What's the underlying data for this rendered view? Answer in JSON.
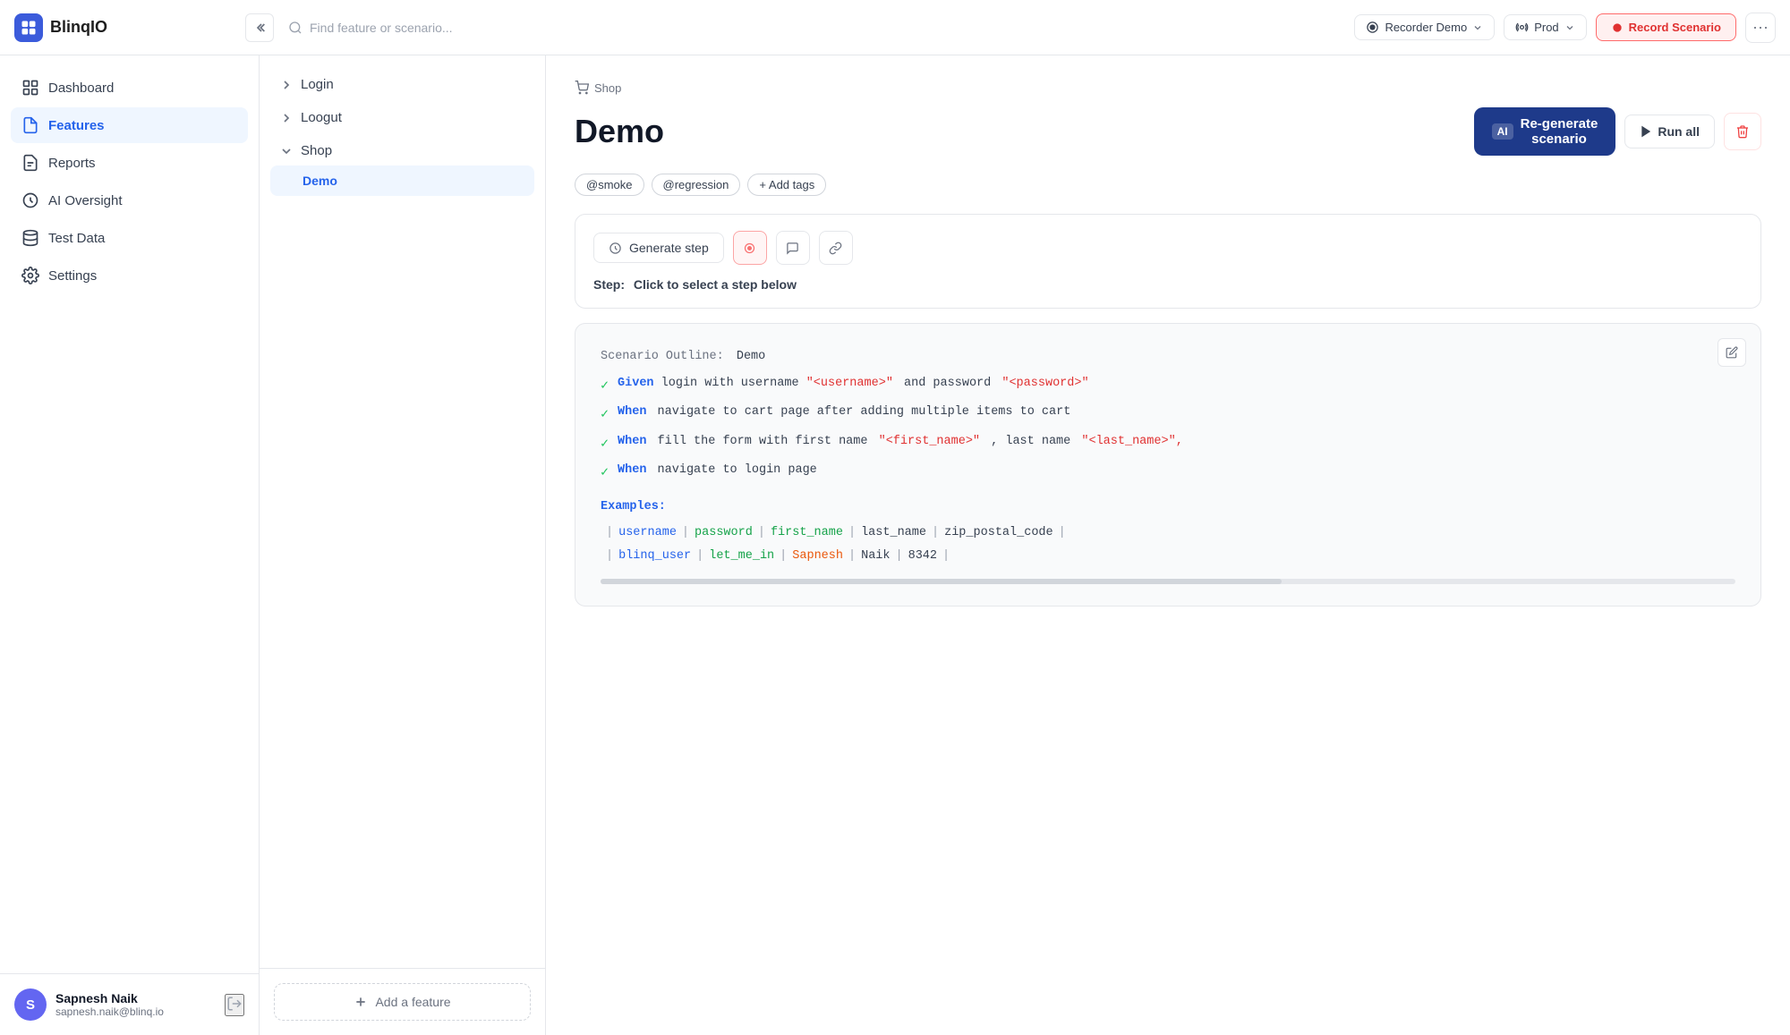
{
  "app": {
    "name": "BlinqIO",
    "logo_alt": "BlinqIO logo"
  },
  "header": {
    "search_placeholder": "Find feature or scenario...",
    "recorder": "Recorder Demo",
    "env": "Prod",
    "record_button": "Record Scenario",
    "more_alt": "more options"
  },
  "sidebar": {
    "nav_items": [
      {
        "id": "dashboard",
        "label": "Dashboard"
      },
      {
        "id": "features",
        "label": "Features",
        "active": true
      },
      {
        "id": "reports",
        "label": "Reports"
      },
      {
        "id": "ai-oversight",
        "label": "AI Oversight"
      },
      {
        "id": "test-data",
        "label": "Test Data"
      },
      {
        "id": "settings",
        "label": "Settings"
      }
    ],
    "user": {
      "name": "Sapnesh Naik",
      "email": "sapnesh.naik@blinq.io",
      "avatar_initial": "S"
    }
  },
  "feature_panel": {
    "groups": [
      {
        "id": "login",
        "label": "Login",
        "expanded": false,
        "scenarios": []
      },
      {
        "id": "loogut",
        "label": "Loogut",
        "expanded": false,
        "scenarios": []
      },
      {
        "id": "shop",
        "label": "Shop",
        "expanded": true,
        "scenarios": [
          {
            "id": "demo",
            "label": "Demo",
            "active": true
          }
        ]
      }
    ],
    "add_button": "Add a feature"
  },
  "main": {
    "breadcrumb": "Shop",
    "title": "Demo",
    "tags": [
      "@smoke",
      "@regression"
    ],
    "add_tag": "+ Add tags",
    "ai_button": {
      "badge": "AI",
      "label": "Re-generate\nscenario"
    },
    "run_all": "Run all",
    "generate_step": "Generate step",
    "step_hint": {
      "prefix": "Step:",
      "text": "Click to select a step below"
    },
    "scenario": {
      "outline_label": "Scenario Outline:",
      "outline_value": "Demo",
      "steps": [
        {
          "keyword": "Given",
          "text": "login with username",
          "param1": "\"<username>\"",
          "mid": "and password",
          "param2": "\"<password>\""
        },
        {
          "keyword": "When",
          "text": "navigate to cart page after adding multiple items to cart"
        },
        {
          "keyword": "When",
          "text": "fill the form with first name",
          "param1": "\"<first_name>\"",
          "mid": ", last name",
          "param2": "\"<last_name>\","
        },
        {
          "keyword": "When",
          "text": "navigate to login page"
        }
      ],
      "examples_label": "Examples:",
      "table_headers": [
        "username",
        "password",
        "first_name",
        "last_name",
        "zip_postal_code"
      ],
      "table_rows": [
        [
          "blinq_user",
          "let_me_in",
          "Sapnesh",
          "Naik",
          "8342"
        ]
      ]
    }
  }
}
